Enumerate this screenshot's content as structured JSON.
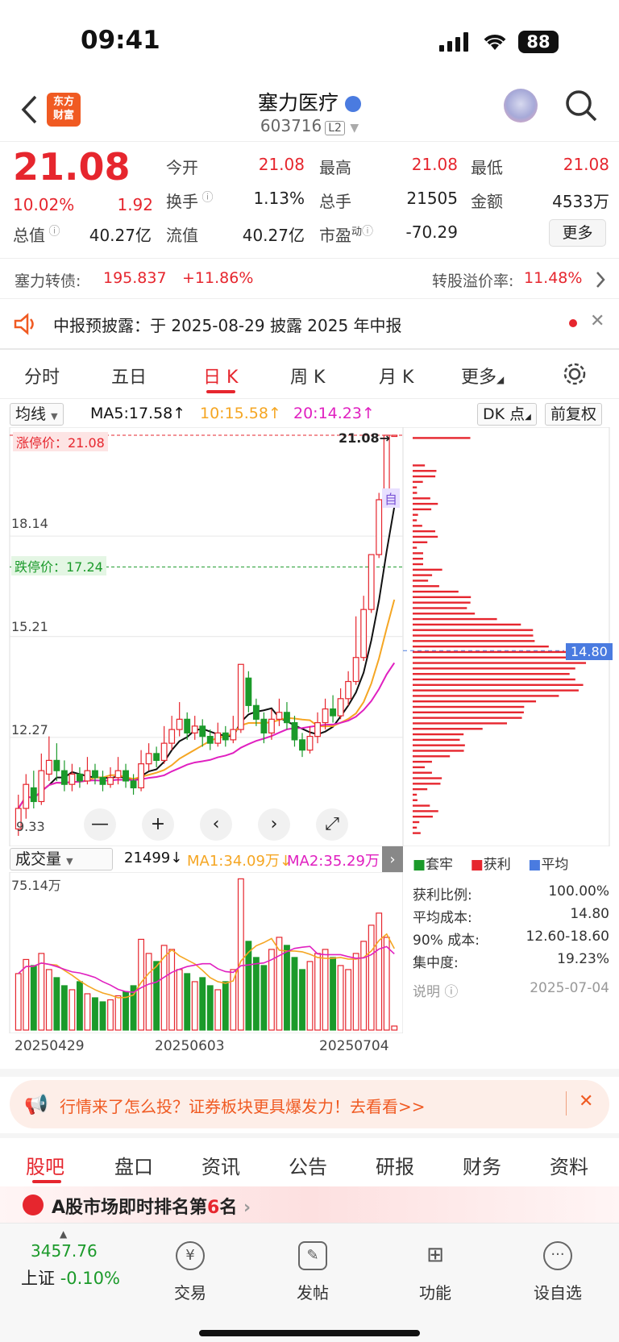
{
  "status": {
    "time": "09:41",
    "battery": "88"
  },
  "header": {
    "title": "塞力医疗",
    "code": "603716",
    "level": "L2",
    "logo": "东方\n财富"
  },
  "quote": {
    "price": "21.08",
    "change_pct": "10.02%",
    "change": "1.92",
    "open_label": "今开",
    "open": "21.08",
    "high_label": "最高",
    "high": "21.08",
    "low_label": "最低",
    "low": "21.08",
    "turnover_label": "换手",
    "turnover": "1.13%",
    "volume_label": "总手",
    "volume": "21505",
    "amount_label": "金额",
    "amount": "4533万",
    "mcap_label": "总值",
    "mcap": "40.27亿",
    "float_label": "流值",
    "float": "40.27亿",
    "pe_label": "市盈",
    "pe_sup": "动",
    "pe": "-70.29",
    "more_button": "更多"
  },
  "bond": {
    "label": "塞力转债:",
    "price": "195.837",
    "change": "+11.86%",
    "premium_label": "转股溢价率:",
    "premium": "11.48%"
  },
  "notice": {
    "text": "中报预披露：于 2025-08-29 披露 2025 年中报"
  },
  "tabs": [
    "分时",
    "五日",
    "日 K",
    "周 K",
    "月 K",
    "更多"
  ],
  "chart_controls": {
    "ma_select": "均线",
    "ma5": "MA5:17.58",
    "ma10": "10:15.58",
    "ma20": "20:14.23",
    "dk_button": "DK 点",
    "adjust_button": "前复权",
    "limit_up": "涨停价：21.08",
    "limit_down": "跌停价：17.24",
    "last_price": "21.08",
    "cost_tag": "14.80",
    "self_tag": "自"
  },
  "vol_controls": {
    "select": "成交量",
    "vol": "21499",
    "ma1": "MA1:34.09万",
    "ma2": "MA2:35.29万",
    "max": "75.14万"
  },
  "colors": {
    "up": "#e6262e",
    "down": "#1b9a2a",
    "ma5": "#111111",
    "ma10": "#f5a623",
    "ma20": "#e020c0",
    "accent": "#f05a22"
  },
  "chart_data": {
    "type": "candlestick",
    "y_ticks": [
      "21.08",
      "18.14",
      "15.21",
      "12.27",
      "9.33"
    ],
    "x_ticks": [
      "20250429",
      "20250603",
      "20250704"
    ],
    "ylim": [
      9.33,
      21.08
    ],
    "candles": [
      {
        "o": 9.6,
        "c": 10.2,
        "h": 10.6,
        "l": 9.4
      },
      {
        "o": 10.2,
        "c": 10.9,
        "h": 11.2,
        "l": 9.9
      },
      {
        "o": 10.8,
        "c": 10.4,
        "h": 11.3,
        "l": 10.2
      },
      {
        "o": 10.4,
        "c": 11.3,
        "h": 11.8,
        "l": 10.3
      },
      {
        "o": 11.2,
        "c": 11.6,
        "h": 12.3,
        "l": 11.0
      },
      {
        "o": 11.6,
        "c": 11.3,
        "h": 12.1,
        "l": 11.0
      },
      {
        "o": 11.3,
        "c": 10.9,
        "h": 11.6,
        "l": 10.7
      },
      {
        "o": 10.9,
        "c": 11.2,
        "h": 11.5,
        "l": 10.7
      },
      {
        "o": 11.2,
        "c": 11.0,
        "h": 11.4,
        "l": 10.8
      },
      {
        "o": 11.0,
        "c": 11.3,
        "h": 11.7,
        "l": 10.9
      },
      {
        "o": 11.3,
        "c": 11.1,
        "h": 11.5,
        "l": 10.9
      },
      {
        "o": 11.1,
        "c": 10.9,
        "h": 11.3,
        "l": 10.7
      },
      {
        "o": 10.9,
        "c": 11.1,
        "h": 11.4,
        "l": 10.8
      },
      {
        "o": 11.1,
        "c": 11.3,
        "h": 11.7,
        "l": 10.9
      },
      {
        "o": 11.3,
        "c": 11.0,
        "h": 11.5,
        "l": 10.8
      },
      {
        "o": 11.0,
        "c": 10.8,
        "h": 11.2,
        "l": 10.6
      },
      {
        "o": 10.8,
        "c": 11.5,
        "h": 11.9,
        "l": 10.7
      },
      {
        "o": 11.5,
        "c": 11.8,
        "h": 12.1,
        "l": 11.3
      },
      {
        "o": 11.8,
        "c": 11.6,
        "h": 12.0,
        "l": 11.4
      },
      {
        "o": 11.6,
        "c": 12.1,
        "h": 12.6,
        "l": 11.5
      },
      {
        "o": 12.1,
        "c": 12.5,
        "h": 12.9,
        "l": 11.9
      },
      {
        "o": 12.5,
        "c": 12.8,
        "h": 13.3,
        "l": 12.3
      },
      {
        "o": 12.8,
        "c": 12.4,
        "h": 13.0,
        "l": 12.2
      },
      {
        "o": 12.4,
        "c": 12.6,
        "h": 12.9,
        "l": 12.2
      },
      {
        "o": 12.6,
        "c": 12.3,
        "h": 12.8,
        "l": 12.0
      },
      {
        "o": 12.3,
        "c": 12.1,
        "h": 12.5,
        "l": 11.9
      },
      {
        "o": 12.1,
        "c": 12.4,
        "h": 12.7,
        "l": 12.0
      },
      {
        "o": 12.4,
        "c": 12.2,
        "h": 12.6,
        "l": 12.0
      },
      {
        "o": 12.2,
        "c": 12.5,
        "h": 12.9,
        "l": 12.1
      },
      {
        "o": 12.5,
        "c": 14.4,
        "h": 14.4,
        "l": 12.4
      },
      {
        "o": 14.0,
        "c": 13.2,
        "h": 14.2,
        "l": 13.0
      },
      {
        "o": 13.2,
        "c": 12.8,
        "h": 13.4,
        "l": 12.6
      },
      {
        "o": 12.8,
        "c": 12.4,
        "h": 13.0,
        "l": 12.1
      },
      {
        "o": 12.4,
        "c": 12.8,
        "h": 13.1,
        "l": 12.2
      },
      {
        "o": 12.8,
        "c": 13.0,
        "h": 13.4,
        "l": 12.6
      },
      {
        "o": 13.0,
        "c": 12.7,
        "h": 13.3,
        "l": 12.5
      },
      {
        "o": 12.7,
        "c": 12.2,
        "h": 12.9,
        "l": 12.0
      },
      {
        "o": 12.2,
        "c": 11.9,
        "h": 12.4,
        "l": 11.7
      },
      {
        "o": 11.9,
        "c": 12.3,
        "h": 12.6,
        "l": 11.8
      },
      {
        "o": 12.3,
        "c": 12.7,
        "h": 13.0,
        "l": 12.1
      },
      {
        "o": 12.7,
        "c": 13.1,
        "h": 13.4,
        "l": 12.5
      },
      {
        "o": 13.1,
        "c": 12.9,
        "h": 13.5,
        "l": 12.7
      },
      {
        "o": 12.9,
        "c": 13.4,
        "h": 13.7,
        "l": 12.8
      },
      {
        "o": 13.4,
        "c": 13.9,
        "h": 14.2,
        "l": 13.2
      },
      {
        "o": 13.9,
        "c": 14.6,
        "h": 15.8,
        "l": 13.8
      },
      {
        "o": 14.6,
        "c": 16.0,
        "h": 16.4,
        "l": 14.5
      },
      {
        "o": 16.0,
        "c": 17.6,
        "h": 17.6,
        "l": 15.9
      },
      {
        "o": 17.6,
        "c": 19.2,
        "h": 19.4,
        "l": 17.5
      },
      {
        "o": 19.2,
        "c": 21.08,
        "h": 21.08,
        "l": 19.1
      },
      {
        "o": 21.08,
        "c": 21.08,
        "h": 21.08,
        "l": 21.08
      }
    ],
    "volumes": [
      28,
      35,
      32,
      38,
      30,
      26,
      22,
      20,
      24,
      18,
      16,
      14,
      15,
      17,
      19,
      22,
      45,
      38,
      34,
      42,
      40,
      30,
      28,
      24,
      26,
      22,
      20,
      24,
      30,
      75,
      44,
      36,
      32,
      40,
      46,
      42,
      36,
      30,
      34,
      38,
      40,
      36,
      32,
      30,
      38,
      44,
      52,
      58,
      46,
      2
    ]
  },
  "chip": {
    "legend": [
      "套牢",
      "获利",
      "平均"
    ],
    "rows": [
      {
        "label": "获利比例:",
        "value": "100.00%"
      },
      {
        "label": "平均成本:",
        "value": "14.80"
      },
      {
        "label": "90% 成本:",
        "value": "12.60-18.60"
      },
      {
        "label": "集中度:",
        "value": "19.23%"
      }
    ],
    "note": "说明",
    "date": "2025-07-04"
  },
  "promo": {
    "text": "行情来了怎么投？证券板块更具爆发力！去看看>>"
  },
  "bottom_tabs": [
    "股吧",
    "盘口",
    "资讯",
    "公告",
    "研报",
    "财务",
    "资料"
  ],
  "rank": {
    "prefix": "A股市场即时排名第",
    "rank": "6",
    "suffix": "名"
  },
  "bottom_nav": {
    "index_value": "3457.76",
    "index_name": "上证",
    "index_change": "-0.10%",
    "items": [
      "交易",
      "发帖",
      "功能",
      "设自选"
    ]
  }
}
